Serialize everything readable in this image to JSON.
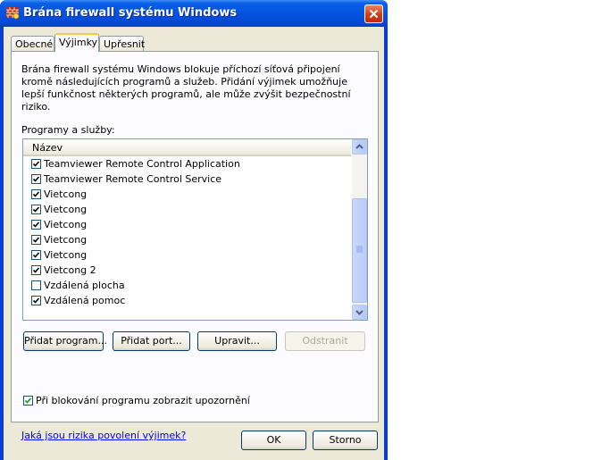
{
  "window": {
    "title": "Brána firewall systému Windows"
  },
  "tabs": [
    {
      "label": "Obecné"
    },
    {
      "label": "Výjimky"
    },
    {
      "label": "Upřesnit"
    }
  ],
  "description": "Brána firewall systému Windows blokuje příchozí síťová připojení kromě následujících programů a služeb. Přidání výjimek umožňuje lepší funkčnost některých programů, ale může zvýšit bezpečnostní riziko.",
  "programs_label": "Programy a služby:",
  "list": {
    "column_header": "Název",
    "items": [
      {
        "label": "Teamviewer Remote Control Application",
        "checked": true
      },
      {
        "label": "Teamviewer Remote Control Service",
        "checked": true
      },
      {
        "label": "Vietcong",
        "checked": true
      },
      {
        "label": "Vietcong",
        "checked": true
      },
      {
        "label": "Vietcong",
        "checked": true
      },
      {
        "label": "Vietcong",
        "checked": true
      },
      {
        "label": "Vietcong",
        "checked": true
      },
      {
        "label": "Vietcong 2",
        "checked": true
      },
      {
        "label": "Vzdálená plocha",
        "checked": false
      },
      {
        "label": "Vzdálená pomoc",
        "checked": true
      }
    ]
  },
  "buttons": {
    "add_program": "Přidat program...",
    "add_port": "Přidat port...",
    "edit": "Upravit...",
    "remove": "Odstranit",
    "ok": "OK",
    "cancel": "Storno"
  },
  "notify": {
    "label": "Při blokování programu zobrazit upozornění",
    "checked": true
  },
  "risk_link": "Jaká jsou rizika povolení výjimek?"
}
